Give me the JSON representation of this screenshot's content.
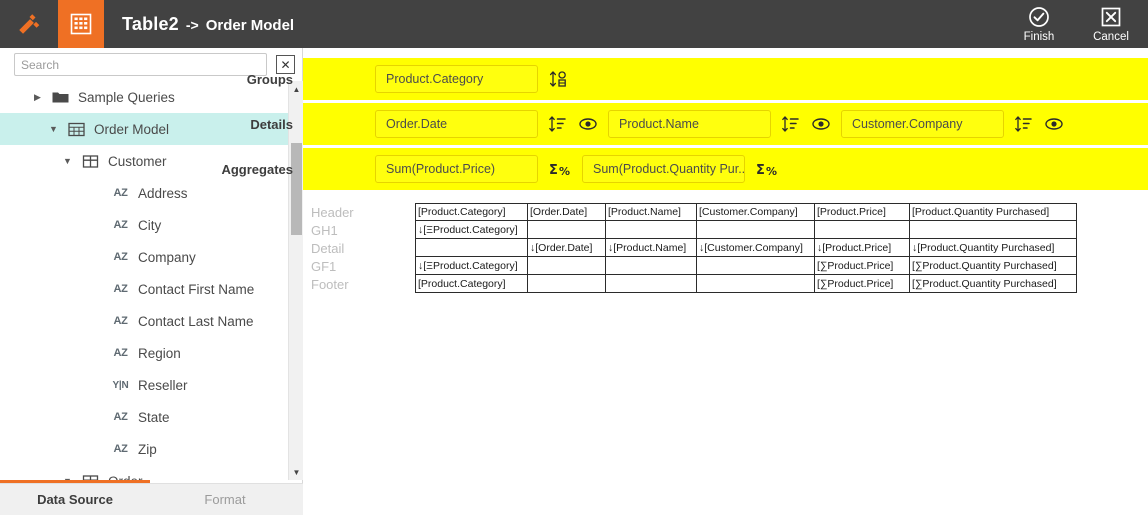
{
  "topbar": {
    "logo_icon": "tools-logo-icon",
    "table_icon": "table-grid-icon",
    "title_main": "Table2",
    "title_sep": "->",
    "title_sub": "Order Model",
    "finish_label": "Finish",
    "cancel_label": "Cancel",
    "finish_icon": "check-circle-icon",
    "cancel_icon": "close-box-icon",
    "bg_color": "#424242",
    "accent_color": "#ef7024"
  },
  "sidebar": {
    "search": {
      "placeholder": "Search",
      "value": "",
      "clear_label": "✕"
    },
    "tree": [
      {
        "label": "Sample Queries",
        "indent": 0,
        "twisty": "▶",
        "icon": "folder-icon",
        "selected": false
      },
      {
        "label": "Order Model",
        "indent": 1,
        "twisty": "▼",
        "icon": "model-icon",
        "selected": true
      },
      {
        "label": "Customer",
        "indent": 2,
        "twisty": "▼",
        "icon": "table-icon",
        "selected": false
      },
      {
        "label": "Address",
        "indent": 3,
        "twisty": "",
        "icon": "az-icon",
        "selected": false
      },
      {
        "label": "City",
        "indent": 3,
        "twisty": "",
        "icon": "az-icon",
        "selected": false
      },
      {
        "label": "Company",
        "indent": 3,
        "twisty": "",
        "icon": "az-icon",
        "selected": false
      },
      {
        "label": "Contact First Name",
        "indent": 3,
        "twisty": "",
        "icon": "az-icon",
        "selected": false
      },
      {
        "label": "Contact Last Name",
        "indent": 3,
        "twisty": "",
        "icon": "az-icon",
        "selected": false
      },
      {
        "label": "Region",
        "indent": 3,
        "twisty": "",
        "icon": "az-icon",
        "selected": false
      },
      {
        "label": "Reseller",
        "indent": 3,
        "twisty": "",
        "icon": "yn-icon",
        "selected": false
      },
      {
        "label": "State",
        "indent": 3,
        "twisty": "",
        "icon": "az-icon",
        "selected": false
      },
      {
        "label": "Zip",
        "indent": 3,
        "twisty": "",
        "icon": "az-icon",
        "selected": false
      },
      {
        "label": "Order",
        "indent": 2,
        "twisty": "▼",
        "icon": "table-icon",
        "selected": false
      }
    ],
    "selected_bg": "#c9f0ec",
    "tabs": {
      "active": "Data Source",
      "inactive": "Format"
    }
  },
  "bands": {
    "band_color": "#ffff00",
    "groups": {
      "label": "Groups",
      "chips": [
        {
          "text": "Product.Category"
        }
      ],
      "sort_icon": "sort-numeric-icon"
    },
    "details": {
      "label": "Details",
      "chips": [
        {
          "text": "Order.Date"
        },
        {
          "text": "Product.Name"
        },
        {
          "text": "Customer.Company"
        }
      ],
      "sort_icon": "sort-lines-icon",
      "visibility_icon": "eye-icon"
    },
    "aggregates": {
      "label": "Aggregates",
      "chips": [
        {
          "text": "Sum(Product.Price)"
        },
        {
          "text": "Sum(Product.Quantity Pur..."
        }
      ],
      "sum_icon": "sigma-percent-icon"
    }
  },
  "grid": {
    "row_labels": [
      "Header",
      "GH1",
      "Detail",
      "GF1",
      "Footer"
    ],
    "rows": [
      {
        "label": "Header",
        "cells": [
          "[Product.Category]",
          "[Order.Date]",
          "[Product.Name]",
          "[Customer.Company]",
          "[Product.Price]",
          "[Product.Quantity Purchased]"
        ]
      },
      {
        "label": "GH1",
        "cells": [
          "↓[ΞProduct.Category]",
          "",
          "",
          "",
          "",
          ""
        ]
      },
      {
        "label": "Detail",
        "cells": [
          "",
          "↓[Order.Date]",
          "↓[Product.Name]",
          "↓[Customer.Company]",
          "↓[Product.Price]",
          "↓[Product.Quantity Purchased]"
        ]
      },
      {
        "label": "GF1",
        "cells": [
          "↓[ΞProduct.Category]",
          "",
          "",
          "",
          "[∑Product.Price]",
          "[∑Product.Quantity Purchased]"
        ]
      },
      {
        "label": "Footer",
        "cells": [
          "[Product.Category]",
          "",
          "",
          "",
          "[∑Product.Price]",
          "[∑Product.Quantity Purchased]"
        ]
      }
    ]
  }
}
